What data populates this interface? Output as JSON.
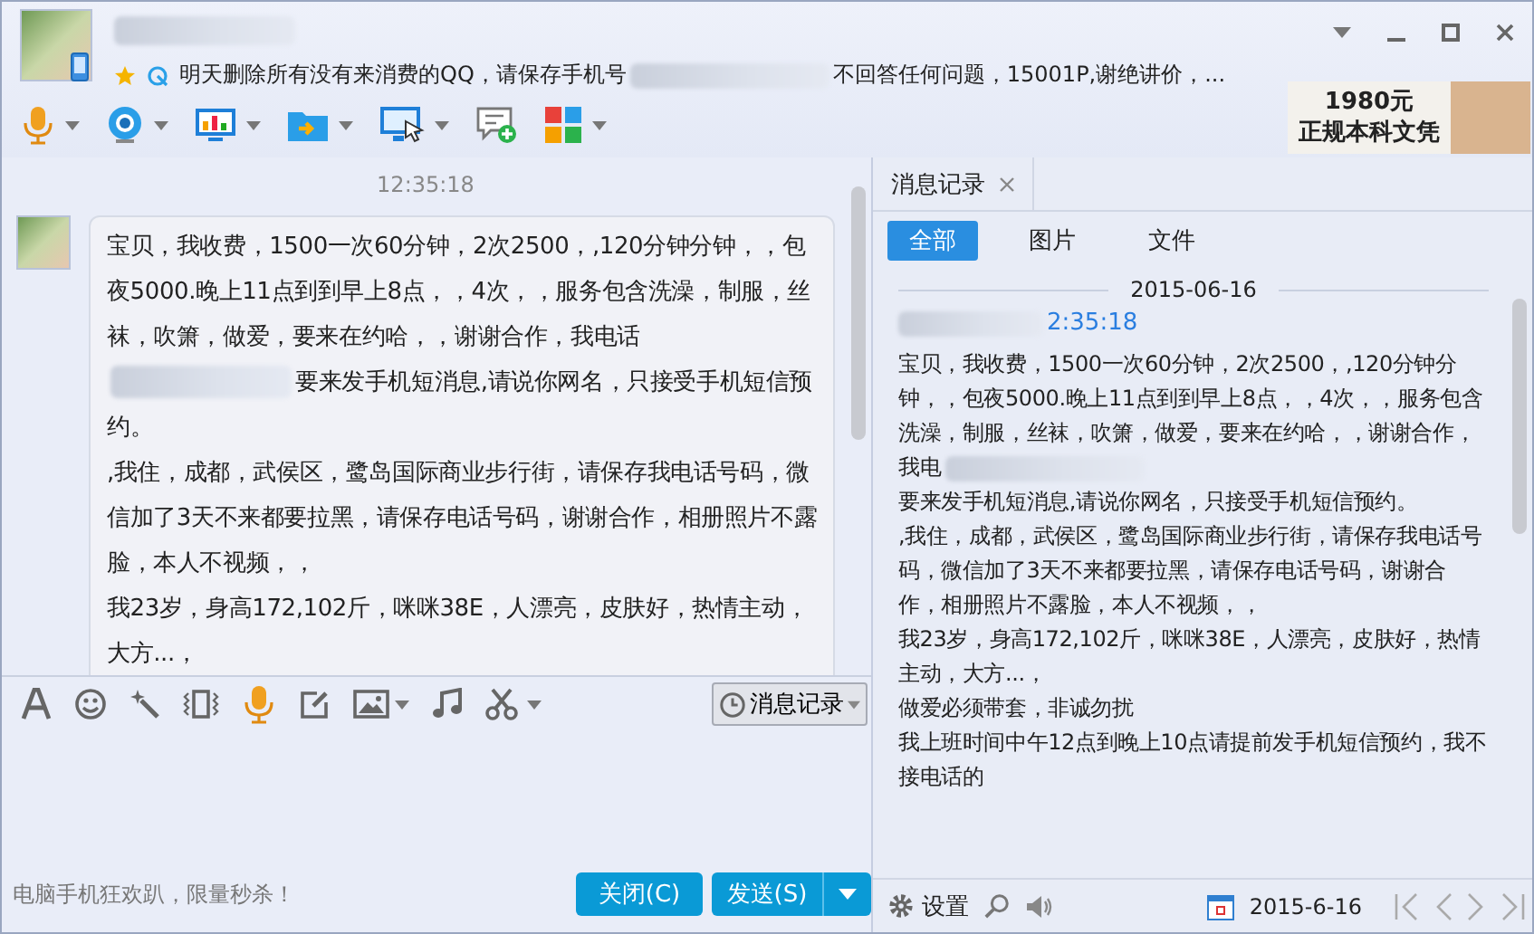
{
  "header": {
    "status_segments": [
      {
        "kind": "text",
        "text": "明天删除所有没有来消费的QQ，请保存手机号"
      },
      {
        "kind": "redacted"
      },
      {
        "kind": "text",
        "text": "不回答任何问题，15001P,谢绝讲价，..."
      }
    ]
  },
  "ad": {
    "lines": [
      "1980元",
      "正规本科文凭"
    ]
  },
  "chat": {
    "time": "12:35:18",
    "paragraphs": [
      [
        {
          "kind": "text",
          "text": "宝贝，我收费，1500一次60分钟，2次2500，,120分钟分钟，，包夜5000.晚上11点到到早上8点，，4次，，服务包含洗澡，制服，丝袜，吹箫，做爱，要来在约哈，，谢谢合作，我电话"
        },
        {
          "kind": "redacted"
        },
        {
          "kind": "text",
          "text": "要来发手机短消息,请说你网名，只接受手机短信预约。"
        }
      ],
      [
        {
          "kind": "text",
          "text": ",我住，成都，武侯区，鹭岛国际商业步行街，请保存我电话号码，微信加了3天不来都要拉黑，请保存电话号码，谢谢合作，相册照片不露脸，本人不视频，，"
        }
      ],
      [
        {
          "kind": "text",
          "text": "我23岁，身高172,102斤，咪咪38E，人漂亮，皮肤好，热情主动，大方...，"
        }
      ]
    ]
  },
  "history_button": {
    "label": "消息记录"
  },
  "promo": "电脑手机狂欢趴，限量秒杀！",
  "buttons": {
    "close": "关闭(C)",
    "send": "发送(S)"
  },
  "history": {
    "tab": {
      "label": "消息记录"
    },
    "filters": [
      {
        "label": "全部",
        "selected": true
      },
      {
        "label": "图片",
        "selected": false
      },
      {
        "label": "文件",
        "selected": false
      }
    ],
    "date": "2015-06-16",
    "time": "2:35:18",
    "paragraphs": [
      [
        {
          "kind": "text",
          "text": "宝贝，我收费，1500一次60分钟，2次2500，,120分钟分钟，，包夜5000.晚上11点到到早上8点，，4次，，服务包含洗澡，制服，丝袜，吹箫，做爱，要来在约哈，，谢谢合作，我电"
        },
        {
          "kind": "redacted"
        }
      ],
      [
        {
          "kind": "text",
          "text": "要来发手机短消息,请说你网名，只接受手机短信预约。"
        }
      ],
      [
        {
          "kind": "text",
          "text": ",我住，成都，武侯区，鹭岛国际商业步行街，请保存我电话号码，微信加了3天不来都要拉黑，请保存电话号码，谢谢合作，相册照片不露脸，本人不视频，，"
        }
      ],
      [
        {
          "kind": "text",
          "text": "我23岁，身高172,102斤，咪咪38E，人漂亮，皮肤好，热情主动，大方...，"
        }
      ],
      [
        {
          "kind": "text",
          "text": "做爱必须带套，非诚勿扰"
        }
      ],
      [
        {
          "kind": "text",
          "text": "我上班时间中午12点到晚上10点请提前发手机短信预约，我不接电话的"
        }
      ]
    ],
    "footer": {
      "settings": "设置",
      "date": "2015-6-16"
    }
  }
}
